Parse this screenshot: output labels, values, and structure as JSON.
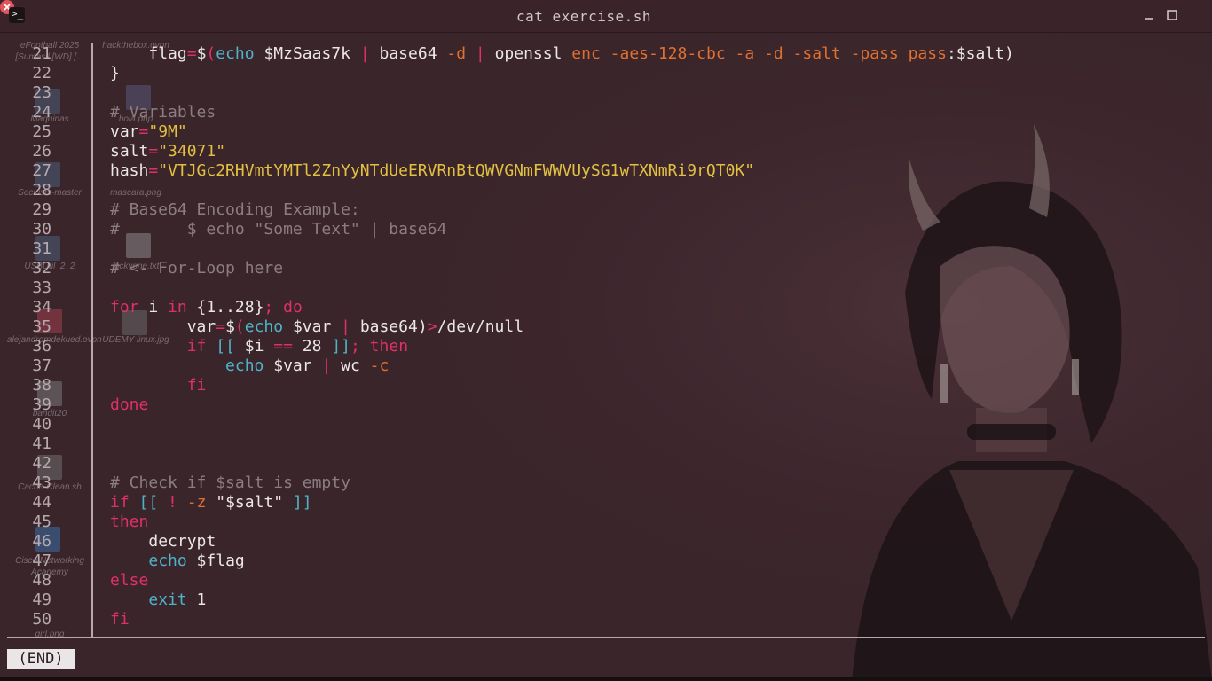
{
  "window": {
    "title": "cat exercise.sh",
    "app_icon": "terminal-icon",
    "controls": [
      "minimize-icon",
      "maximize-icon",
      "close-icon"
    ]
  },
  "gutter": {
    "line_numbers": [
      "21",
      "22",
      "23",
      "24",
      "25",
      "26",
      "27",
      "28",
      "29",
      "30",
      "31",
      "32",
      "33",
      "34",
      "35",
      "36",
      "37",
      "38",
      "39",
      "40",
      "41",
      "42",
      "43",
      "44",
      "45",
      "46",
      "47",
      "48",
      "49",
      "50"
    ]
  },
  "code": {
    "line21": {
      "indent": "    ",
      "t1": "flag",
      "t2": "=",
      "t3": "$(",
      "t4": "echo",
      "t5": " $MzSaas7k ",
      "t6": "|",
      "t7": " base64 ",
      "t8": "-d",
      "t9": " ",
      "t10": "|",
      "t11": " openssl ",
      "t12": "enc -aes-128-cbc -a -d -salt -pass pass",
      "t13": ":$salt)"
    },
    "line22": "}",
    "line23": "",
    "line24": "# Variables",
    "line25": {
      "a": "var",
      "b": "=",
      "c": "\"9M\""
    },
    "line26": {
      "a": "salt",
      "b": "=",
      "c": "\"34071\""
    },
    "line27": {
      "a": "hash",
      "b": "=",
      "c": "\"VTJGc2RHVmtYMTl2ZnYyNTdUeERVRnBtQWVGNmFWWVUySG1wTXNmRi9rQT0K\""
    },
    "line28": "",
    "line29": "# Base64 Encoding Example:",
    "line30": "#       $ echo \"Some Text\" | base64",
    "line31": "",
    "line32": "# <- For-Loop here",
    "line33": "",
    "line34": {
      "a": "for",
      "b": " i ",
      "c": "in",
      "d": " {1..28}",
      "e": ";",
      "f": " do"
    },
    "line35": {
      "indent": "        ",
      "a": "var",
      "b": "=",
      "c": "$(",
      "d": "echo",
      "e": " $var ",
      "f": "|",
      "g": " base64)",
      "h": ">",
      "i": "/dev/null"
    },
    "line36": {
      "indent": "        ",
      "a": "if",
      "b": " [[ ",
      "c": "$i ",
      "d": "==",
      "e": " 28 ",
      "f": "]]",
      "g": ";",
      "h": " then"
    },
    "line37": {
      "indent": "            ",
      "a": "echo",
      "b": " $var ",
      "c": "|",
      "d": " wc ",
      "e": "-c"
    },
    "line38": {
      "indent": "        ",
      "a": "fi"
    },
    "line39": "done",
    "line40": "",
    "line41": "",
    "line42": "",
    "line43": "# Check if $salt is empty",
    "line44": {
      "a": "if",
      "b": " [[ ",
      "c": "!",
      "d": " ",
      "e": "-z",
      "f": " \"$salt\" ",
      "g": "]]"
    },
    "line45": "then",
    "line46": {
      "indent": "    ",
      "a": "decrypt"
    },
    "line47": {
      "indent": "    ",
      "a": "echo",
      "b": " $flag"
    },
    "line48": "else",
    "line49": {
      "indent": "    ",
      "a": "exit",
      "b": " 1"
    },
    "line50": "fi"
  },
  "status": {
    "pager": "(END)"
  },
  "desktop_icons": [
    {
      "label": "eFootball 2025 [Sumasil [WD] [...",
      "icon": "game-icon"
    },
    {
      "label": "hackthebox.ovpn",
      "icon": "file-icon"
    },
    {
      "label": "Maquinas",
      "icon": "folder-icon"
    },
    {
      "label": "hola.php",
      "icon": "php-file-icon"
    },
    {
      "label": "SecLists-master",
      "icon": "folder-icon"
    },
    {
      "label": "mascara.png",
      "icon": "image-icon"
    },
    {
      "label": "USBUtil_2_2",
      "icon": "folder-icon"
    },
    {
      "label": "luckyone.txt",
      "icon": "text-file-icon"
    },
    {
      "label": "alejandromdekued.ovpn",
      "icon": "file-icon"
    },
    {
      "label": "UDEMY linux.jpg",
      "icon": "image-icon"
    },
    {
      "label": "bandit20",
      "icon": "file-icon"
    },
    {
      "label": "Cache-Clean.sh",
      "icon": "script-icon"
    },
    {
      "label": "Cisco Networking Academy",
      "icon": "app-icon"
    },
    {
      "label": "girl.png",
      "icon": "image-icon"
    }
  ],
  "colors": {
    "background": "#3a252b",
    "keyword": "#e0306a",
    "builtin": "#4fb3c8",
    "string": "#e3c042",
    "comment": "#8b7d82",
    "flag": "#e07030"
  }
}
